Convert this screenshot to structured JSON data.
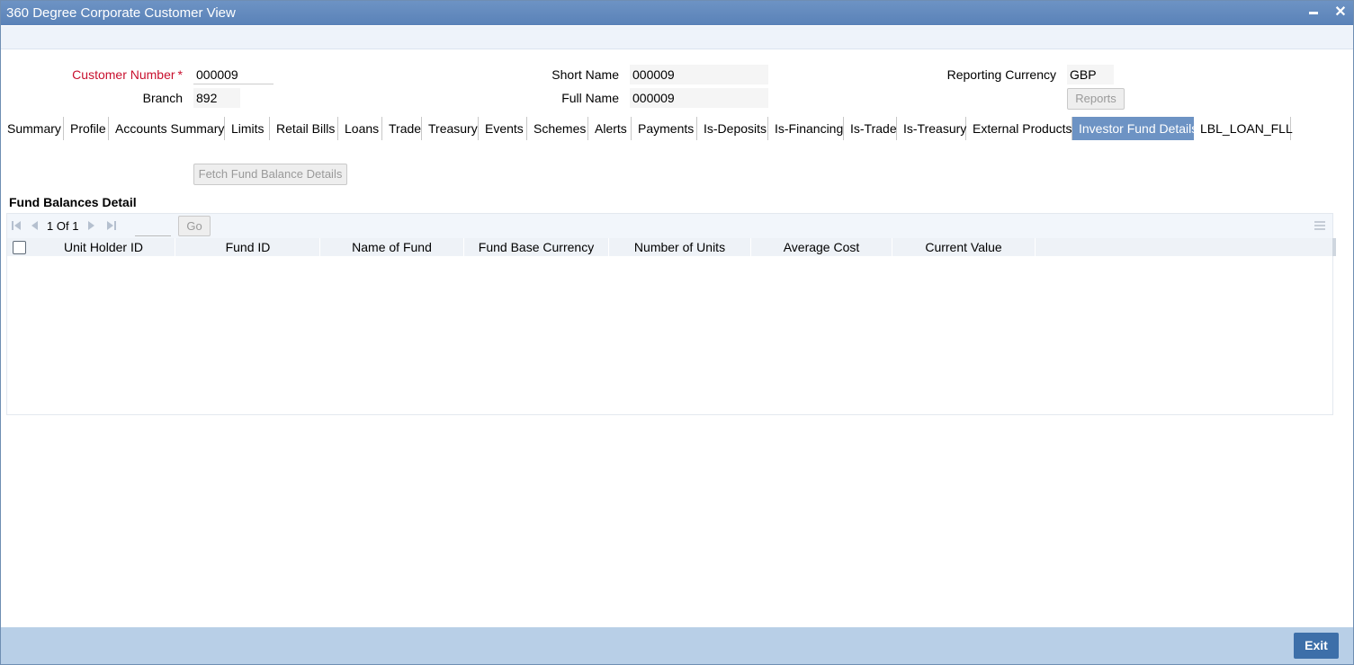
{
  "window": {
    "title": "360 Degree Corporate Customer View",
    "minimize_glyph": "▬",
    "close_glyph": "✕"
  },
  "form": {
    "customer_number_label": "Customer Number",
    "customer_number_required": "*",
    "customer_number_value": "000009",
    "branch_label": "Branch",
    "branch_value": "892",
    "short_name_label": "Short Name",
    "short_name_value": "000009",
    "full_name_label": "Full Name",
    "full_name_value": "000009",
    "reporting_currency_label": "Reporting Currency",
    "reporting_currency_value": "GBP",
    "reports_button": "Reports"
  },
  "tabs": [
    {
      "label": "Summary"
    },
    {
      "label": "Profile"
    },
    {
      "label": "Accounts Summary"
    },
    {
      "label": "Limits"
    },
    {
      "label": "Retail Bills"
    },
    {
      "label": "Loans"
    },
    {
      "label": "Trade"
    },
    {
      "label": "Treasury"
    },
    {
      "label": "Events"
    },
    {
      "label": "Schemes"
    },
    {
      "label": "Alerts"
    },
    {
      "label": "Payments"
    },
    {
      "label": "Is-Deposits"
    },
    {
      "label": "Is-Financing"
    },
    {
      "label": "Is-Trade"
    },
    {
      "label": "Is-Treasury"
    },
    {
      "label": "External Products"
    },
    {
      "label": "Investor Fund Details",
      "active": true
    },
    {
      "label": "LBL_LOAN_FLL"
    }
  ],
  "fund": {
    "fetch_button": "Fetch Fund Balance Details",
    "section_title": "Fund Balances Detail",
    "pagination": {
      "current": "1",
      "of_label": "Of",
      "total": "1",
      "go_label": "Go"
    },
    "columns": [
      "Unit Holder ID",
      "Fund ID",
      "Name of Fund",
      "Fund Base Currency",
      "Number of Units",
      "Average Cost",
      "Current Value"
    ],
    "rows": []
  },
  "footer": {
    "exit_label": "Exit"
  },
  "colors": {
    "titlebar": "#5a82b8",
    "active_tab": "#6d93c4",
    "footer": "#b8cfe7",
    "exit_button": "#3d6fa9",
    "required_label": "#c8102e"
  }
}
